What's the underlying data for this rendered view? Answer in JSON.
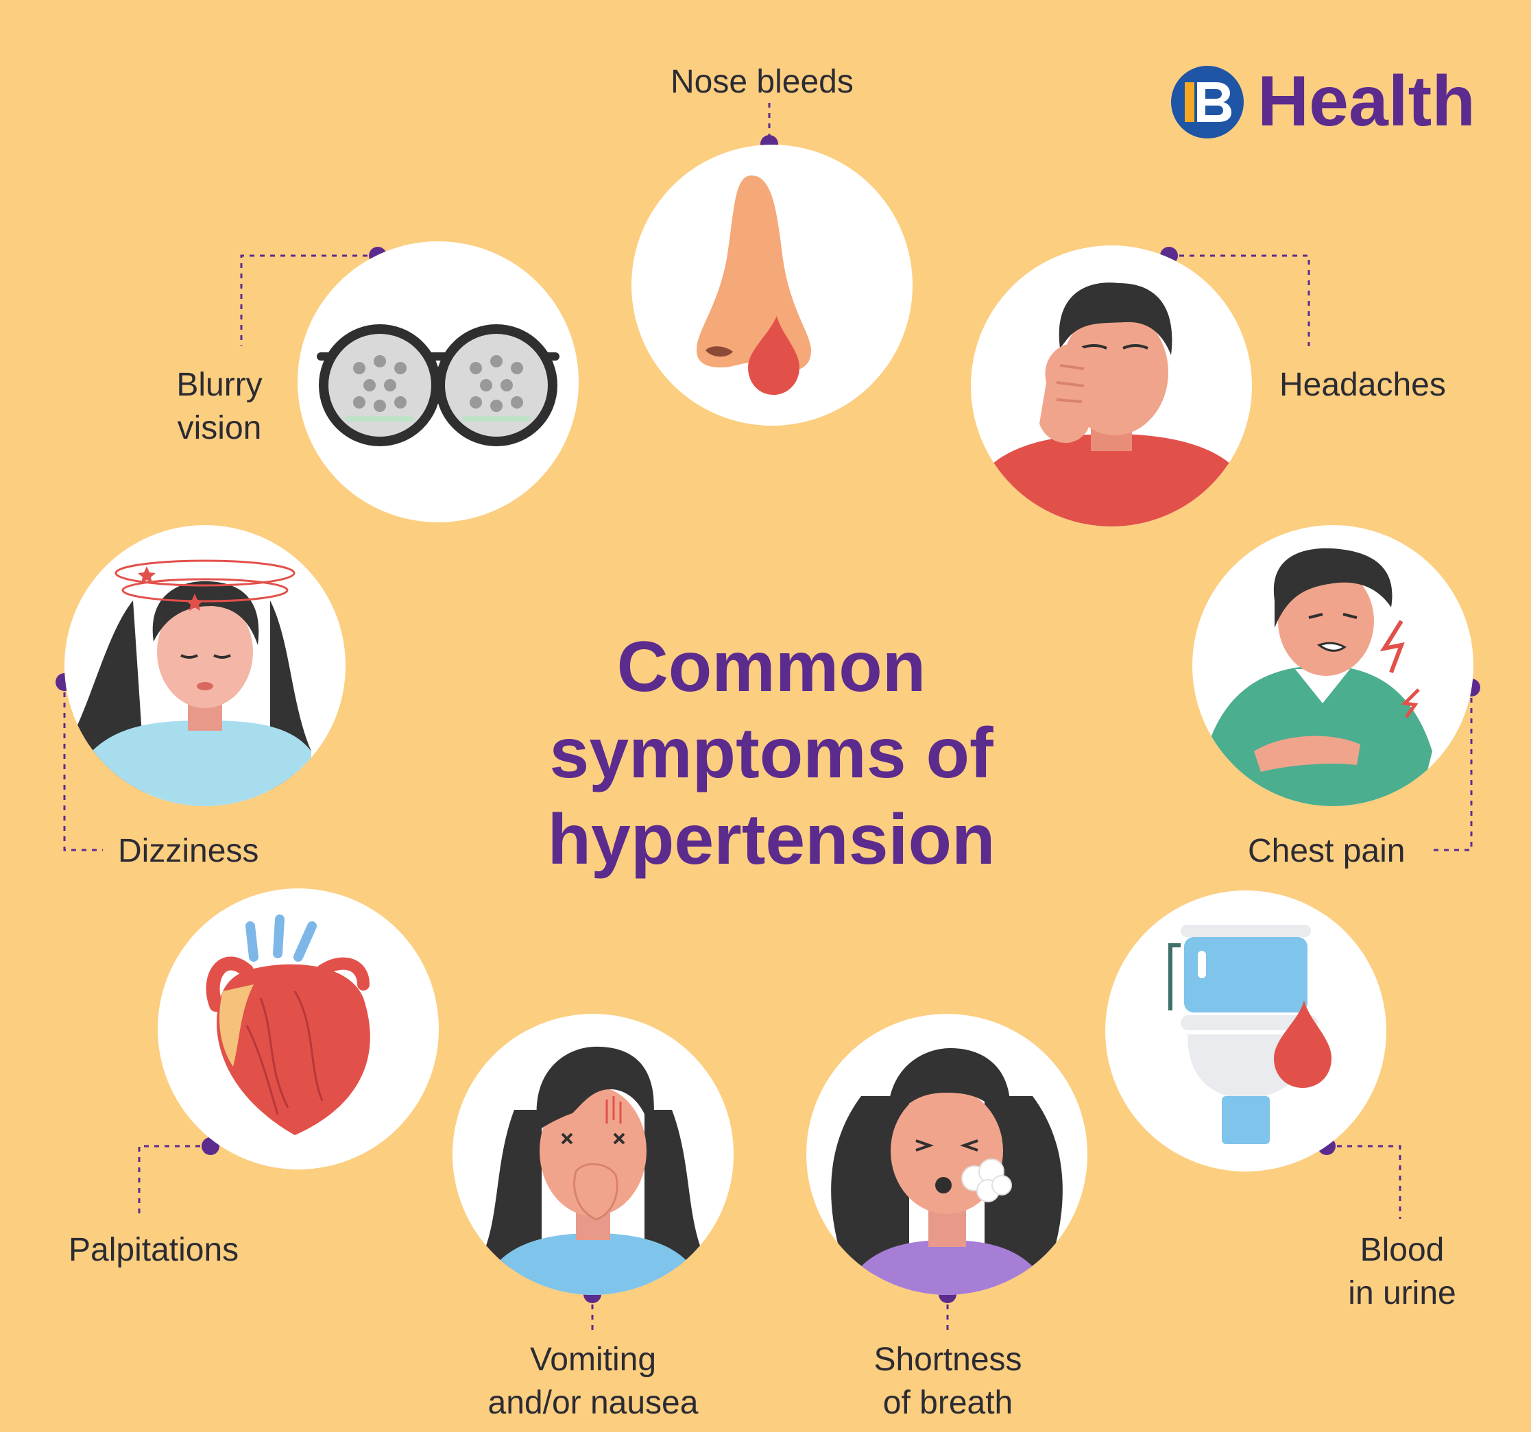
{
  "brand": {
    "logo_text": "Health",
    "color_primary": "#5B2B8E",
    "color_logo_mark": "#1F55A5"
  },
  "title": {
    "lines": [
      "Common",
      "symptoms of",
      "hypertension"
    ]
  },
  "symptoms": {
    "nose_bleeds": {
      "label": "Nose bleeds",
      "icon": "nose-bleed-icon"
    },
    "blurry_vision": {
      "line1": "Blurry",
      "line2": "vision",
      "icon": "blurry-glasses-icon"
    },
    "headaches": {
      "label": "Headaches",
      "icon": "headache-person-icon"
    },
    "dizziness": {
      "label": "Dizziness",
      "icon": "dizzy-woman-icon"
    },
    "chest_pain": {
      "label": "Chest pain",
      "icon": "chest-pain-person-icon"
    },
    "palpitations": {
      "label": "Palpitations",
      "icon": "heart-icon"
    },
    "vomiting": {
      "line1": "Vomiting",
      "line2": "and/or nausea",
      "icon": "nauseous-woman-icon"
    },
    "shortness": {
      "line1": "Shortness",
      "line2": "of breath",
      "icon": "breathless-woman-icon"
    },
    "blood_urine": {
      "line1": "Blood",
      "line2": "in urine",
      "icon": "toilet-blood-icon"
    }
  },
  "colors": {
    "background": "#FCCE80",
    "circle": "#FFFFFF",
    "label_text": "#2B2B33",
    "connector": "#5B2B8E",
    "blood": "#E2504A"
  }
}
